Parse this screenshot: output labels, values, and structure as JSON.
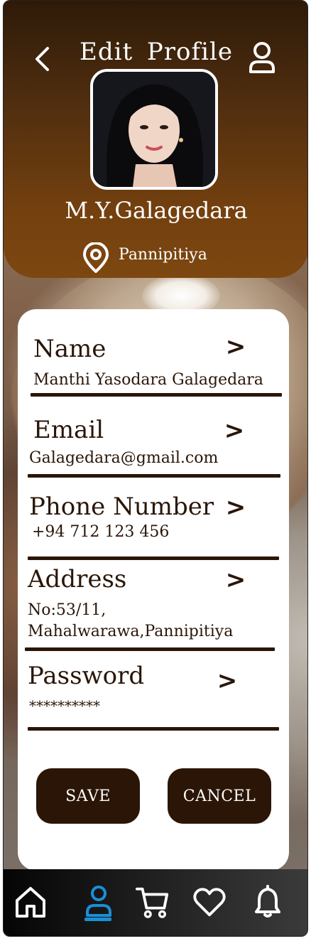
{
  "header": {
    "title": "Edit  Profile",
    "user_name": "M.Y.Galagedara",
    "location": "Pannipitiya",
    "icons": {
      "back": "chevron-left-icon",
      "profile": "user-icon",
      "location": "map-pin-icon"
    }
  },
  "fields": [
    {
      "label": "Name",
      "value": "Manthi Yasodara Galagedara"
    },
    {
      "label": "Email",
      "value": "Galagedara@gmail.com"
    },
    {
      "label": "Phone Number",
      "value": "+94 712 123 456"
    },
    {
      "label": "Address",
      "value_line1": "No:53/11,",
      "value_line2": "Mahalwarawa,Pannipitiya"
    },
    {
      "label": "Password",
      "value": "**********"
    }
  ],
  "chevron": ">",
  "buttons": {
    "save": "SAVE",
    "cancel": "CANCEL"
  },
  "navbar": {
    "items": [
      "home-icon",
      "user-icon",
      "cart-icon",
      "heart-icon",
      "bell-icon"
    ],
    "active": "user-icon",
    "active_color": "#1a8fd6"
  },
  "colors": {
    "header_dark": "#2e1a08",
    "header_light": "#7d4710",
    "button": "#2b1506",
    "text": "#2a1608"
  }
}
